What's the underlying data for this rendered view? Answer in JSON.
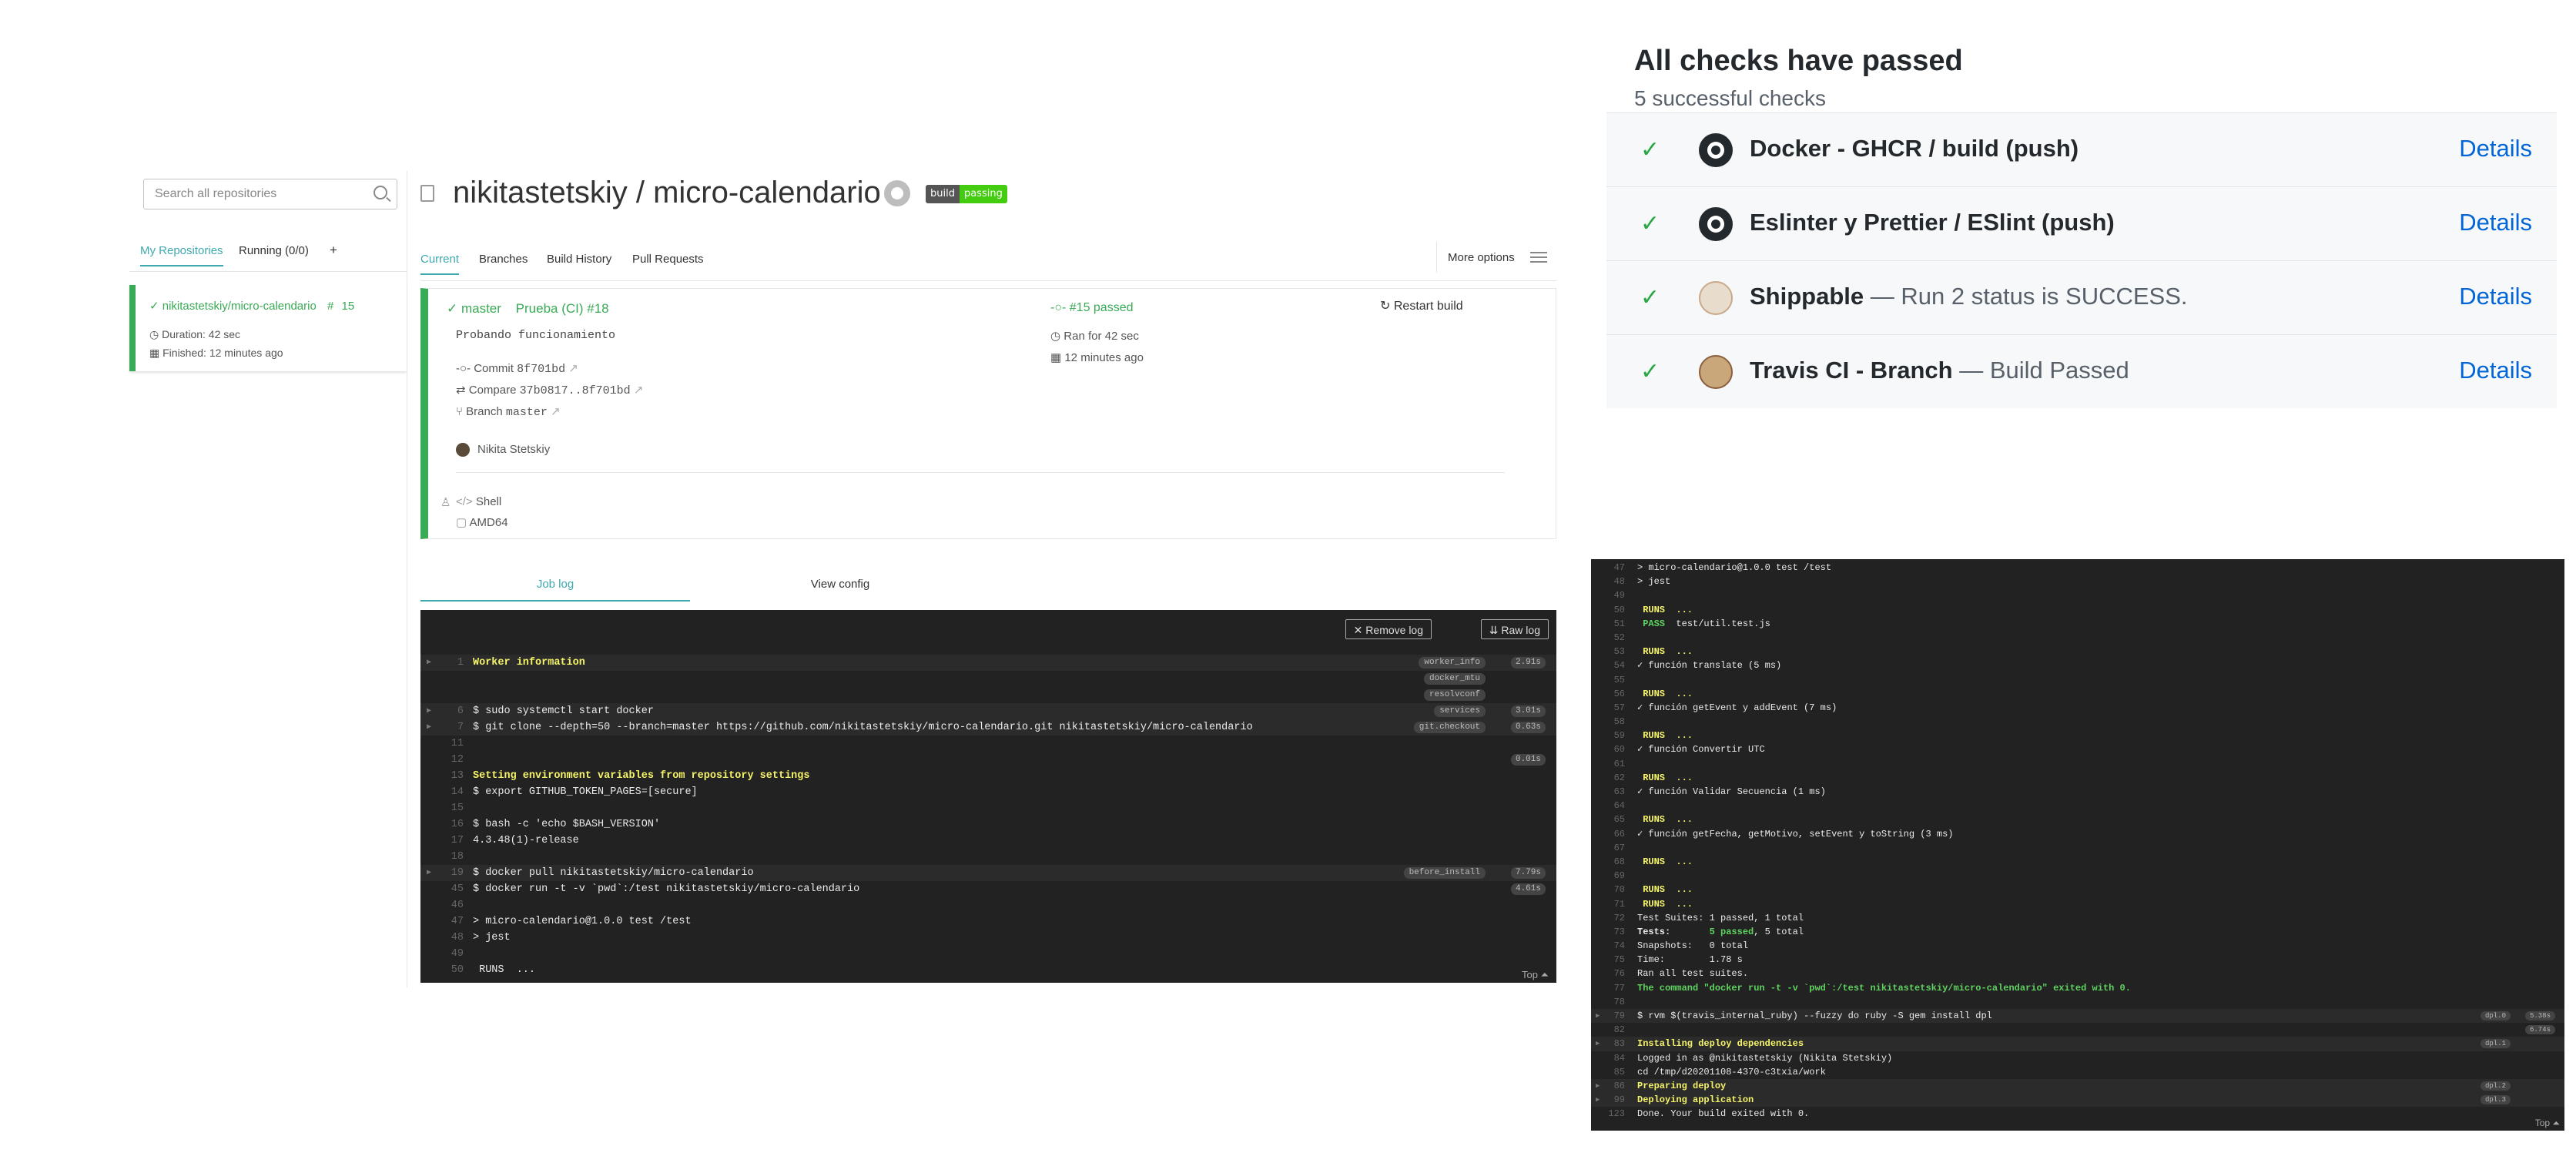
{
  "sidebar": {
    "search_placeholder": "Search all repositories",
    "tabs": [
      "My Repositories",
      "Running (0/0)",
      "+"
    ],
    "repo": {
      "name": "nikitastetskiy/micro-calendario",
      "build_number": "15",
      "duration": "Duration: 42 sec",
      "finished": "Finished: 12 minutes ago"
    }
  },
  "main": {
    "title": "nikitastetskiy / micro-calendario",
    "badge": {
      "left": "build",
      "right": "passing"
    },
    "tabs": [
      "Current",
      "Branches",
      "Build History",
      "Pull Requests"
    ],
    "more_options": "More options",
    "build": {
      "branch": "master",
      "workflow": "Prueba (CI) #18",
      "message": "Probando funcionamiento",
      "commit_label": "Commit",
      "commit": "8f701bd",
      "compare_label": "Compare",
      "compare": "37b0817..8f701bd",
      "branch_label": "Branch",
      "branch_name": "master",
      "author": "Nikita Stetskiy",
      "status": "#15 passed",
      "ran_for": "Ran for 42 sec",
      "ago": "12 minutes ago",
      "restart": "Restart build",
      "language": "Shell",
      "arch": "AMD64"
    },
    "log_tabs": [
      "Job log",
      "View config"
    ],
    "log_buttons": {
      "remove": "Remove log",
      "raw": "Raw log"
    },
    "log_lines": [
      {
        "n": "1",
        "t": "Worker information",
        "y": true,
        "fold": true,
        "tag": "worker_info",
        "dur": "2.91s"
      },
      {
        "n": "",
        "t": "",
        "tag": "docker_mtu"
      },
      {
        "n": "",
        "t": "",
        "tag": "resolvconf"
      },
      {
        "n": "6",
        "t": "$ sudo systemctl start docker",
        "fold": true,
        "tag": "services",
        "dur": "3.01s"
      },
      {
        "n": "7",
        "t": "$ git clone --depth=50 --branch=master https://github.com/nikitastetskiy/micro-calendario.git nikitastetskiy/micro-calendario",
        "fold": true,
        "tag": "git.checkout",
        "dur": "0.63s"
      },
      {
        "n": "11",
        "t": ""
      },
      {
        "n": "12",
        "t": "",
        "dur": "0.01s"
      },
      {
        "n": "13",
        "t": "Setting environment variables from repository settings",
        "y": true
      },
      {
        "n": "14",
        "t": "$ export GITHUB_TOKEN_PAGES=[secure]"
      },
      {
        "n": "15",
        "t": ""
      },
      {
        "n": "16",
        "t": "$ bash -c 'echo $BASH_VERSION'"
      },
      {
        "n": "17",
        "t": "4.3.48(1)-release"
      },
      {
        "n": "18",
        "t": ""
      },
      {
        "n": "19",
        "t": "$ docker pull nikitastetskiy/micro-calendario",
        "fold": true,
        "tag": "before_install",
        "dur": "7.79s"
      },
      {
        "n": "45",
        "t": "$ docker run -t -v `pwd`:/test nikitastetskiy/micro-calendario",
        "dur": "4.61s"
      },
      {
        "n": "46",
        "t": ""
      },
      {
        "n": "47",
        "t": "> micro-calendario@1.0.0 test /test"
      },
      {
        "n": "48",
        "t": "> jest"
      },
      {
        "n": "49",
        "t": ""
      },
      {
        "n": "50",
        "t": " RUNS  ..."
      }
    ],
    "top_link": "Top"
  },
  "checks": {
    "title": "All checks have passed",
    "subtitle": "5 successful checks",
    "rows": [
      {
        "name": "Docker - GHCR / build (push)",
        "desc": "",
        "logo": "github-icon"
      },
      {
        "name": "Eslinter y Prettier / ESlint (push)",
        "desc": "",
        "logo": "github-icon"
      },
      {
        "name": "Shippable",
        "desc": " — Run 2 status is SUCCESS.",
        "logo": "shippable-icon"
      },
      {
        "name": "Travis CI - Branch",
        "desc": " — Build Passed",
        "logo": "travis-icon"
      }
    ],
    "details_label": "Details"
  },
  "right_log": {
    "lines": [
      {
        "n": "47",
        "t": "> micro-calendario@1.0.0 test /test"
      },
      {
        "n": "48",
        "t": "> jest"
      },
      {
        "n": "49",
        "t": ""
      },
      {
        "n": "50",
        "t": " RUNS  ...",
        "y": true
      },
      {
        "n": "51",
        "t": " PASS  test/util.test.js",
        "pass": true
      },
      {
        "n": "52",
        "t": ""
      },
      {
        "n": "53",
        "t": " RUNS  ...",
        "y": true
      },
      {
        "n": "54",
        "t": "✓ función translate (5 ms)"
      },
      {
        "n": "55",
        "t": ""
      },
      {
        "n": "56",
        "t": " RUNS  ...",
        "y": true
      },
      {
        "n": "57",
        "t": "✓ función getEvent y addEvent (7 ms)"
      },
      {
        "n": "58",
        "t": ""
      },
      {
        "n": "59",
        "t": " RUNS  ...",
        "y": true
      },
      {
        "n": "60",
        "t": "✓ función Convertir UTC"
      },
      {
        "n": "61",
        "t": ""
      },
      {
        "n": "62",
        "t": " RUNS  ...",
        "y": true
      },
      {
        "n": "63",
        "t": "✓ función Validar Secuencia (1 ms)"
      },
      {
        "n": "64",
        "t": ""
      },
      {
        "n": "65",
        "t": " RUNS  ...",
        "y": true
      },
      {
        "n": "66",
        "t": "✓ función getFecha, getMotivo, setEvent y toString (3 ms)"
      },
      {
        "n": "67",
        "t": ""
      },
      {
        "n": "68",
        "t": " RUNS  ...",
        "y": true
      },
      {
        "n": "69",
        "t": ""
      },
      {
        "n": "70",
        "t": " RUNS  ...",
        "y": true
      },
      {
        "n": "71",
        "t": " RUNS  ...",
        "y": true
      },
      {
        "n": "72",
        "t": "Test Suites: 1 passed, 1 total",
        "summary": true
      },
      {
        "n": "73",
        "t": "Tests:       5 passed, 5 total",
        "summary": true
      },
      {
        "n": "74",
        "t": "Snapshots:   0 total"
      },
      {
        "n": "75",
        "t": "Time:        1.78 s"
      },
      {
        "n": "76",
        "t": "Ran all test suites."
      },
      {
        "n": "77",
        "t": "The command \"docker run -t -v `pwd`:/test nikitastetskiy/micro-calendario\" exited with 0.",
        "g": true
      },
      {
        "n": "78",
        "t": ""
      },
      {
        "n": "79",
        "t": "$ rvm $(travis_internal_ruby) --fuzzy do ruby -S gem install dpl",
        "fold": true,
        "tag": "dpl.0",
        "dur": "5.38s"
      },
      {
        "n": "82",
        "t": "",
        "dur": "6.74s"
      },
      {
        "n": "83",
        "t": "Installing deploy dependencies",
        "y": true,
        "fold": true,
        "tag": "dpl.1"
      },
      {
        "n": "84",
        "t": "Logged in as @nikitastetskiy (Nikita Stetskiy)"
      },
      {
        "n": "85",
        "t": "cd /tmp/d20201108-4370-c3txia/work"
      },
      {
        "n": "86",
        "t": "Preparing deploy",
        "y": true,
        "fold": true,
        "tag": "dpl.2"
      },
      {
        "n": "99",
        "t": "Deploying application",
        "y": true,
        "fold": true,
        "tag": "dpl.3"
      },
      {
        "n": "123",
        "t": "Done. Your build exited with 0."
      }
    ],
    "top_link": "Top"
  }
}
